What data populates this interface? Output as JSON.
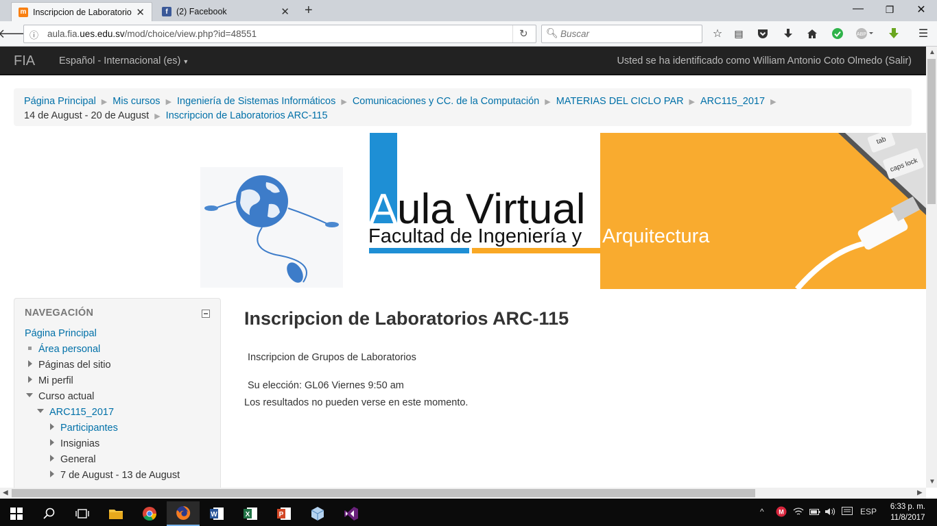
{
  "browser": {
    "tabs": [
      {
        "title": "Inscripcion de Laboratorios ARC-115",
        "active": true,
        "icon": "moodle-icon"
      },
      {
        "title": "(2) Facebook",
        "active": false,
        "icon": "facebook-icon"
      }
    ],
    "url_prefix": "aula.fia.",
    "url_domain": "ues.edu.sv",
    "url_path": "/mod/choice/view.php?id=48551",
    "search_placeholder": "Buscar"
  },
  "moodle": {
    "brand": "FIA",
    "language": "Español - Internacional (es)",
    "user_info": "Usted se ha identificado como William Antonio Coto Olmedo (Salir)"
  },
  "breadcrumb": [
    "Página Principal",
    "Mis cursos",
    "Ingeniería de Sistemas Informáticos",
    "Comunicaciones y CC. de la Computación",
    "MATERIAS DEL CICLO PAR",
    "ARC115_2017",
    "14 de August - 20 de August",
    "Inscripcion de Laboratorios ARC-115"
  ],
  "banner": {
    "title_part1": "A",
    "title_part2": "ula Virtual",
    "subtitle_part1": "Facultad de Ingeniería y ",
    "subtitle_part2": "Arquitectura",
    "keycap_1": "tab",
    "keycap_2": "caps lock"
  },
  "navigation": {
    "title": "NAVEGACIÓN",
    "items": [
      "Página Principal",
      "Área personal",
      "Páginas del sitio",
      "Mi perfil",
      "Curso actual",
      "ARC115_2017",
      "Participantes",
      "Insignias",
      "General",
      "7 de August - 13 de August"
    ]
  },
  "main": {
    "title": "Inscripcion de Laboratorios ARC-115",
    "intro": "Inscripcion de Grupos de Laboratorios",
    "choice": "Su elección: GL06 Viernes 9:50 am",
    "results_note": "Los resultados no pueden verse en este momento."
  },
  "taskbar": {
    "language": "ESP",
    "time": "6:33 p. m.",
    "date": "11/8/2017"
  }
}
